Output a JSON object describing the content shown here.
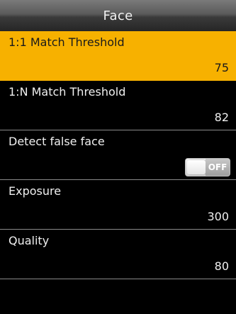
{
  "header": {
    "title": "Face"
  },
  "settings": [
    {
      "label": "1:1 Match Threshold",
      "value": "75",
      "selected": true
    },
    {
      "label": "1:N Match Threshold",
      "value": "82",
      "selected": false
    },
    {
      "label": "Detect false face",
      "toggle": "OFF",
      "selected": false
    },
    {
      "label": "Exposure",
      "value": "300",
      "selected": false
    },
    {
      "label": "Quality",
      "value": "80",
      "selected": false
    }
  ],
  "colors": {
    "selected_bg": "#f7b100",
    "screen_bg": "#000000"
  },
  "icons": {
    "toggle": "toggle-switch-off"
  }
}
